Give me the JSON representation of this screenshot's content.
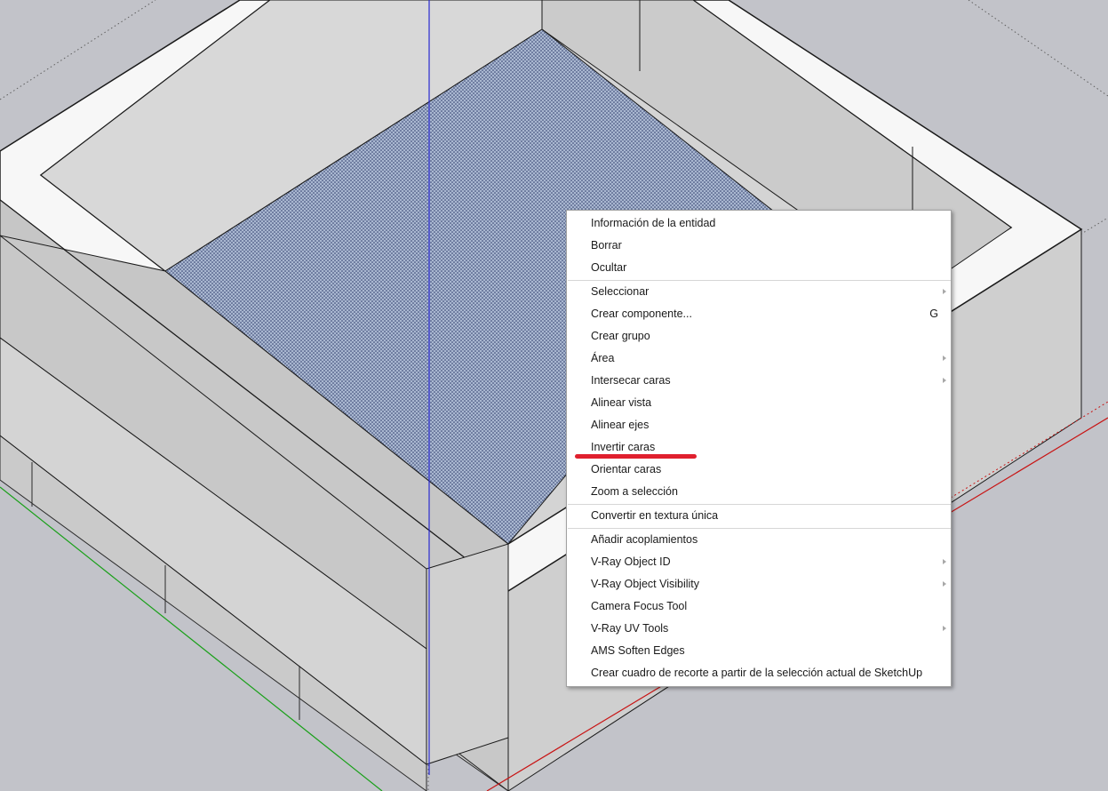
{
  "colors": {
    "background": "#c2c3c9",
    "wall_top": "#f7f7f7",
    "wall_side": "#d0d0d0",
    "wall_shade": "#c4c4c4",
    "selected_face": "#98a8c4",
    "axis_blue": "#2a2ad0",
    "axis_green": "#1aa01a",
    "axis_red": "#c81414",
    "highlight_underline": "#e0202e"
  },
  "context_menu": {
    "groups": [
      [
        {
          "label": "Información de la entidad",
          "submenu": false
        },
        {
          "label": "Borrar",
          "submenu": false
        },
        {
          "label": "Ocultar",
          "submenu": false
        }
      ],
      [
        {
          "label": "Seleccionar",
          "submenu": true
        },
        {
          "label": "Crear componente...",
          "shortcut": "G",
          "submenu": false
        },
        {
          "label": "Crear grupo",
          "submenu": false
        },
        {
          "label": "Área",
          "submenu": true
        },
        {
          "label": "Intersecar caras",
          "submenu": true
        },
        {
          "label": "Alinear vista",
          "submenu": false
        },
        {
          "label": "Alinear ejes",
          "submenu": false
        },
        {
          "label": "Invertir caras",
          "submenu": false,
          "annotated": true
        },
        {
          "label": "Orientar caras",
          "submenu": false
        },
        {
          "label": "Zoom a selección",
          "submenu": false
        }
      ],
      [
        {
          "label": "Convertir en textura única",
          "submenu": false
        }
      ],
      [
        {
          "label": "Añadir acoplamientos",
          "submenu": false
        },
        {
          "label": "V-Ray Object ID",
          "submenu": true
        },
        {
          "label": "V-Ray Object Visibility",
          "submenu": true
        },
        {
          "label": "Camera Focus Tool",
          "submenu": false
        },
        {
          "label": "V-Ray UV Tools",
          "submenu": true
        },
        {
          "label": "AMS Soften Edges",
          "submenu": false
        },
        {
          "label": "Crear cuadro de recorte a partir de la selección actual de SketchUp",
          "submenu": false
        }
      ]
    ]
  }
}
